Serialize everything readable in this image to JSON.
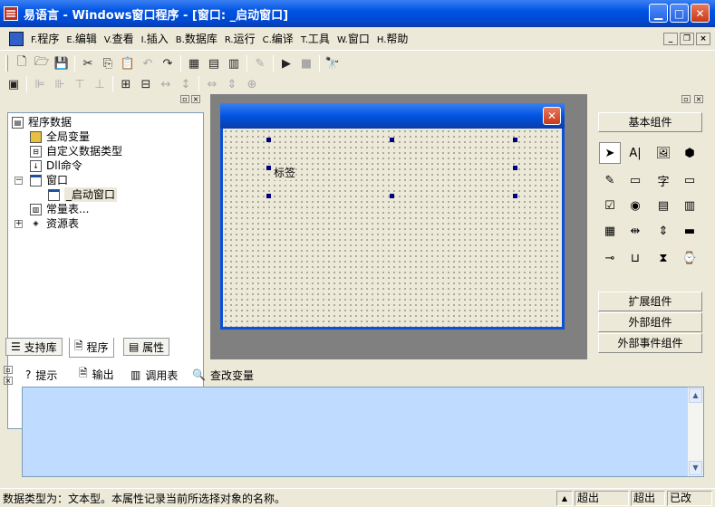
{
  "window": {
    "title": "易语言 - Windows窗口程序 - [窗口: _启动窗口]",
    "app_icon": "easy-language-icon",
    "minimize_glyph": "▁",
    "maximize_glyph": "□",
    "close_glyph": "✕"
  },
  "menu": [
    {
      "key": "F.",
      "label": "程序"
    },
    {
      "key": "E.",
      "label": "编辑"
    },
    {
      "key": "V.",
      "label": "查看"
    },
    {
      "key": "I.",
      "label": "插入"
    },
    {
      "key": "B.",
      "label": "数据库"
    },
    {
      "key": "R.",
      "label": "运行"
    },
    {
      "key": "C.",
      "label": "编译"
    },
    {
      "key": "T.",
      "label": "工具"
    },
    {
      "key": "W.",
      "label": "窗口"
    },
    {
      "key": "H.",
      "label": "帮助"
    }
  ],
  "mdi_controls": {
    "min": "_",
    "restore": "❐",
    "close": "×"
  },
  "toolbar1_icons": [
    "new-file",
    "open-folder",
    "save",
    "cut",
    "copy",
    "paste",
    "undo",
    "redo",
    "layout-1",
    "layout-2",
    "layout-3",
    "edit-pen",
    "run",
    "stop",
    "find-binoculars"
  ],
  "toolbar2_icons": [
    "form",
    "align-left",
    "align-center",
    "align-top",
    "align-bottom",
    "center-h",
    "center-v",
    "space-h",
    "space-v",
    "same-width",
    "same-height",
    "same-size"
  ],
  "tree": {
    "root": "程序数据",
    "items": [
      {
        "label": "全局变量",
        "icon": "database-icon"
      },
      {
        "label": "自定义数据类型",
        "icon": "type-icon"
      },
      {
        "label": "Dll命令",
        "icon": "dll-icon"
      },
      {
        "label": "窗口",
        "icon": "window-icon",
        "expanded": true
      },
      {
        "label": "_启动窗口",
        "icon": "window-icon",
        "selected": true
      },
      {
        "label": "常量表...",
        "icon": "constant-icon"
      },
      {
        "label": "资源表",
        "icon": "resource-icon",
        "collapsed": true
      }
    ]
  },
  "left_tabs": [
    {
      "label": "支持库",
      "icon": "library-icon"
    },
    {
      "label": "程序",
      "icon": "program-icon",
      "active": true
    },
    {
      "label": "属性",
      "icon": "property-icon"
    }
  ],
  "designer": {
    "label_text": "标签",
    "close_glyph": "✕"
  },
  "components": {
    "basic_button": "基本组件",
    "extended_button": "扩展组件",
    "external_button": "外部组件",
    "external_event_button": "外部事件组件",
    "icons": [
      "pointer",
      "label",
      "picture",
      "shape",
      "edit",
      "button-cn",
      "text",
      "frame",
      "checkbox",
      "radio",
      "listbox",
      "combobox",
      "list",
      "scroll-h",
      "scroll-v",
      "progress",
      "slider",
      "tab",
      "timer",
      "dialog"
    ]
  },
  "output_tabs": [
    {
      "label": "提示",
      "icon": "help-icon"
    },
    {
      "label": "输出",
      "icon": "output-icon"
    },
    {
      "label": "调用表",
      "icon": "call-table-icon"
    },
    {
      "label": "查改变量",
      "icon": "magnifier-icon"
    }
  ],
  "status": {
    "message": "数据类型为：文本型。本属性记录当前所选择对象的名称。",
    "cell1": "超出",
    "cell2": "超出",
    "cell3": "已改"
  }
}
